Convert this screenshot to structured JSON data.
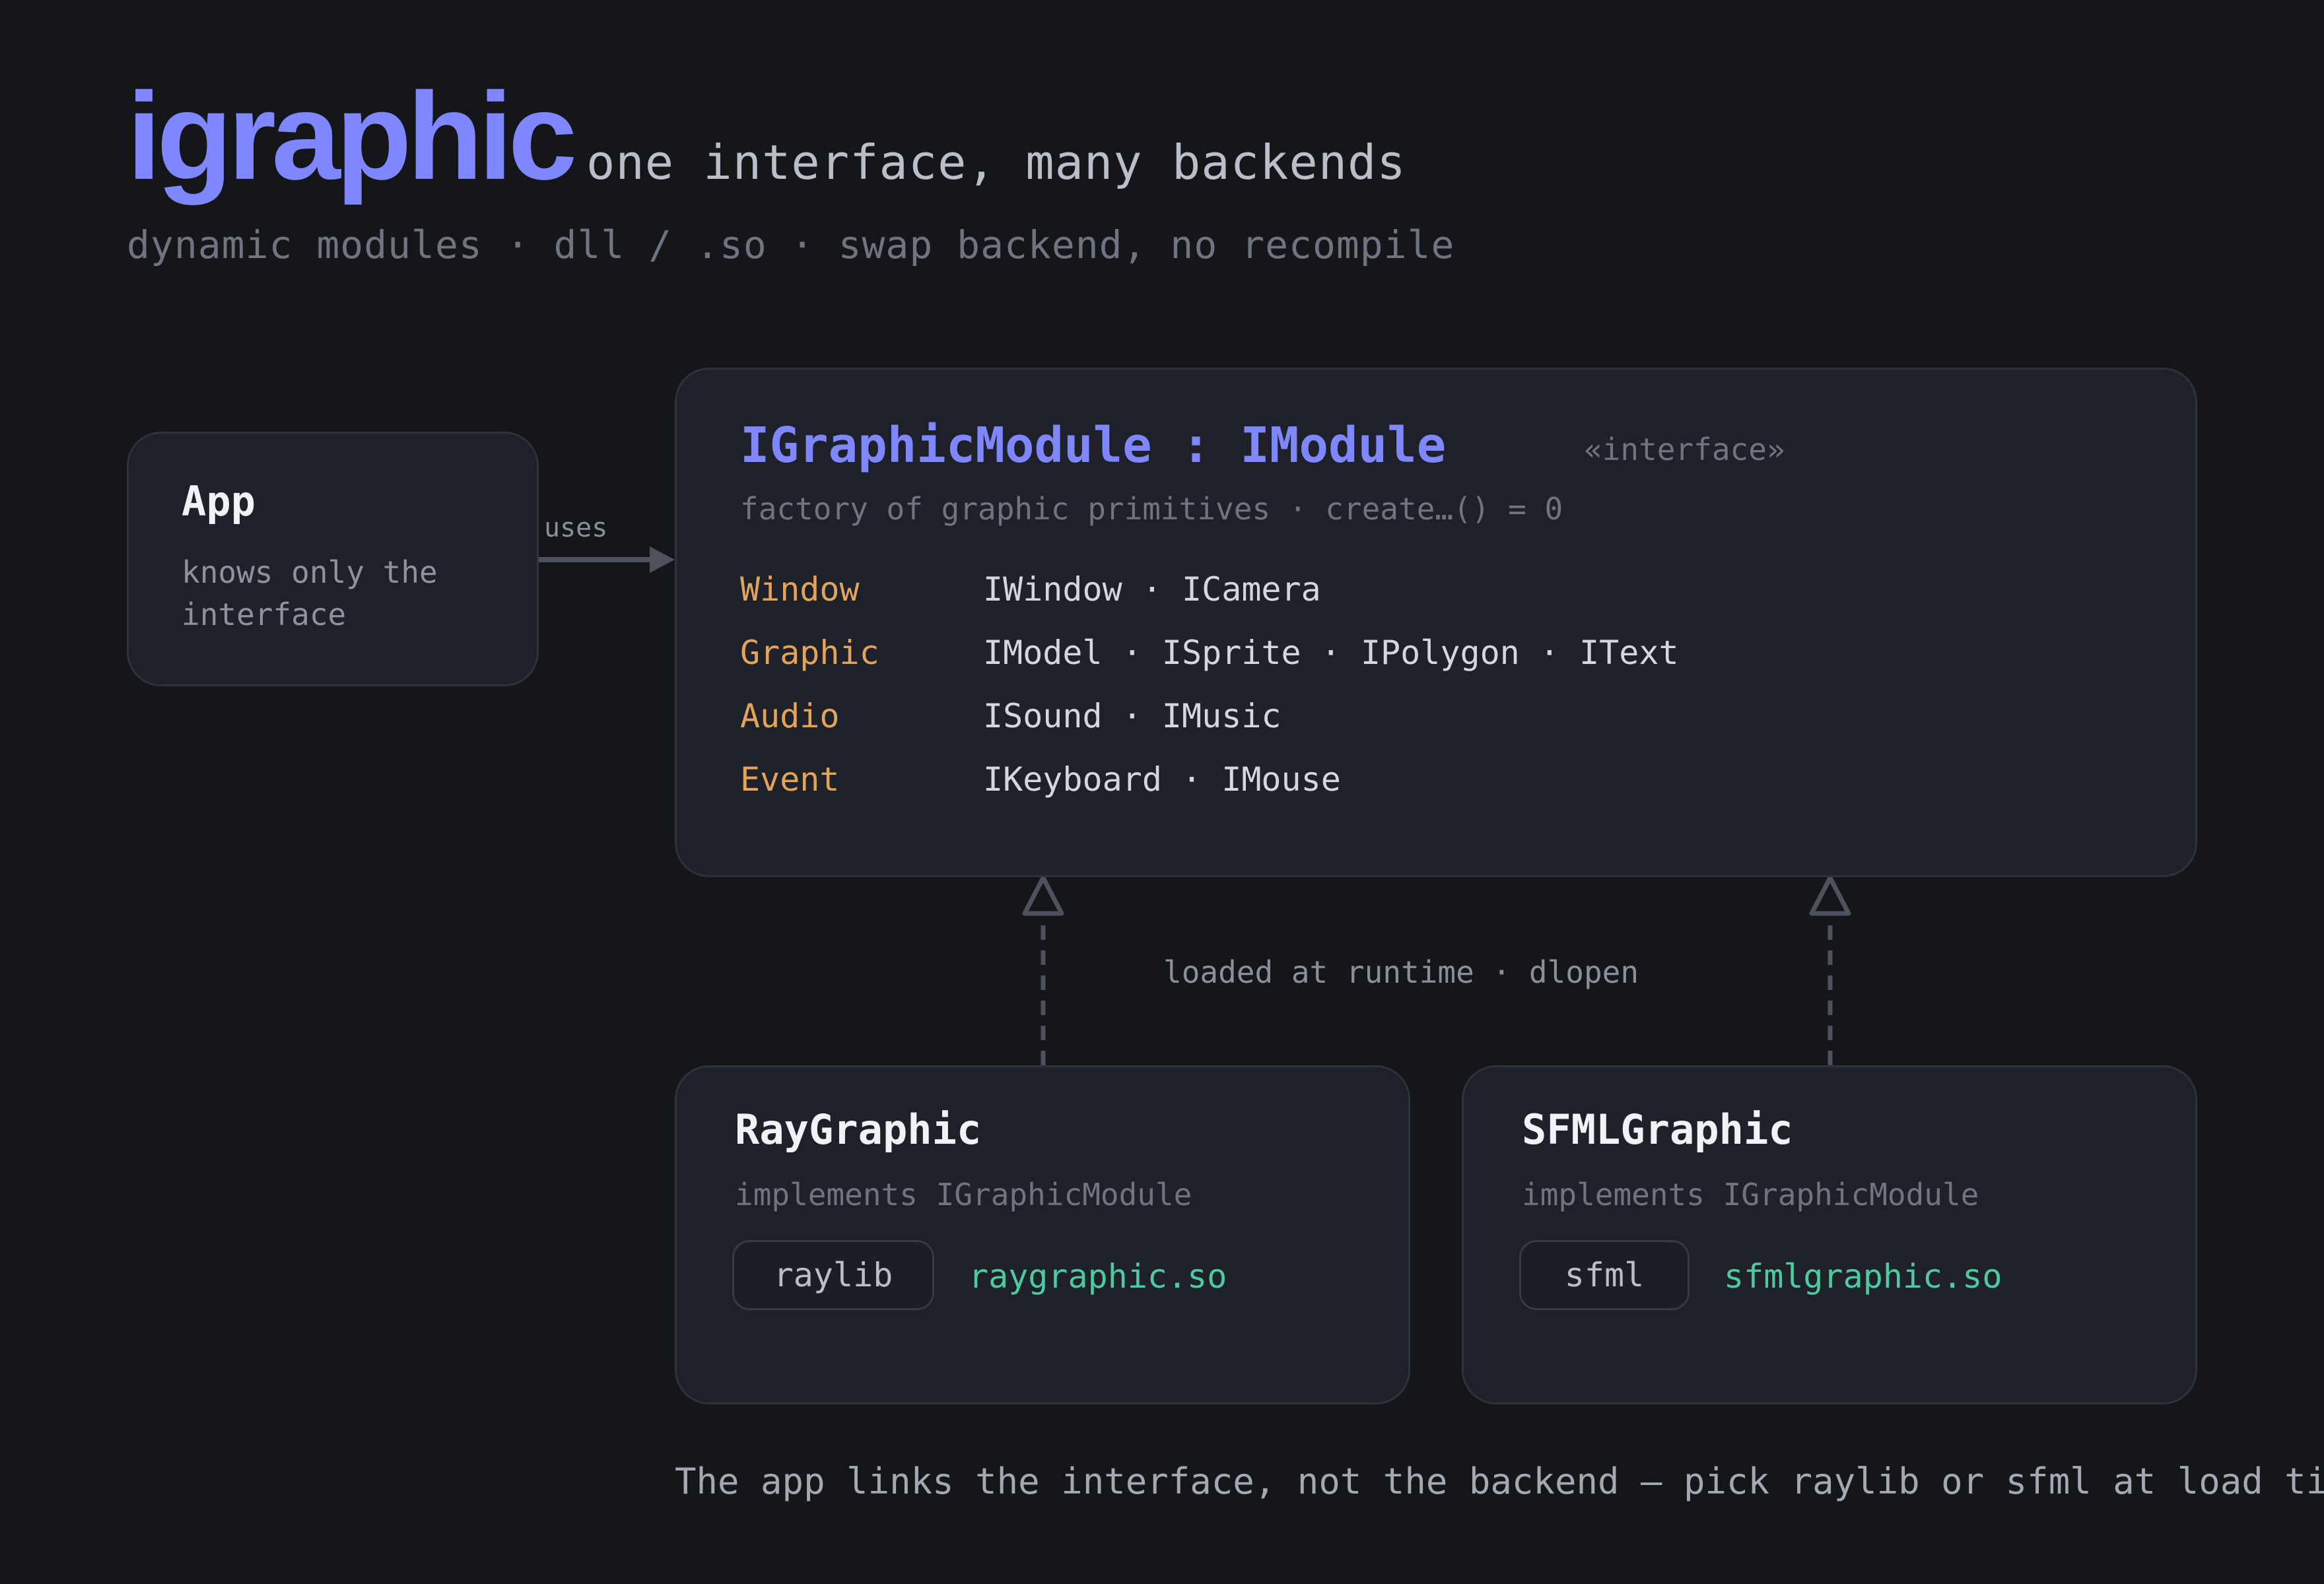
{
  "header": {
    "brand": "igraphic",
    "tagline": "one interface, many backends",
    "subtitle": "dynamic modules · dll / .so · swap backend, no recompile"
  },
  "app": {
    "title": "App",
    "description": "knows only the interface"
  },
  "edge_uses": {
    "label": "uses"
  },
  "interface_card": {
    "title": "IGraphicModule : IModule",
    "stereotype": "«interface»",
    "description": "factory of graphic primitives · create…() = 0",
    "categories": [
      {
        "name": "Window",
        "items": "IWindow · ICamera"
      },
      {
        "name": "Graphic",
        "items": "IModel · ISprite · IPolygon · IText"
      },
      {
        "name": "Audio",
        "items": "ISound · IMusic"
      },
      {
        "name": "Event",
        "items": "IKeyboard · IMouse"
      }
    ]
  },
  "edge_runtime": {
    "label": "loaded at runtime · dlopen"
  },
  "backends": [
    {
      "title": "RayGraphic",
      "subtitle": "implements IGraphicModule",
      "library": "raylib",
      "file": "raygraphic.so"
    },
    {
      "title": "SFMLGraphic",
      "subtitle": "implements IGraphicModule",
      "library": "sfml",
      "file": "sfmlgraphic.so"
    }
  ],
  "footer": "The app links the interface, not the backend — pick raylib or sfml at load time.",
  "colors": {
    "background": "#15161a",
    "card": "#1e2129",
    "accent": "#7f87ff",
    "category": "#e2a45a",
    "file": "#4ec9a0",
    "connector": "#4d525c"
  }
}
